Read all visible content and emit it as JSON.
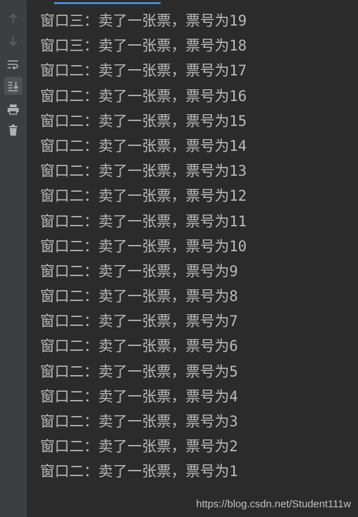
{
  "toolbar": {
    "icons": [
      {
        "name": "up-arrow-icon",
        "active": false
      },
      {
        "name": "down-arrow-icon",
        "active": false
      },
      {
        "name": "soft-wrap-icon",
        "active": false
      },
      {
        "name": "scroll-to-end-icon",
        "active": true
      },
      {
        "name": "print-icon",
        "active": false
      },
      {
        "name": "trash-icon",
        "active": false
      }
    ]
  },
  "console": {
    "lines": [
      "窗口三：卖了一张票，票号为19",
      "窗口三：卖了一张票，票号为18",
      "窗口二：卖了一张票，票号为17",
      "窗口二：卖了一张票，票号为16",
      "窗口二：卖了一张票，票号为15",
      "窗口二：卖了一张票，票号为14",
      "窗口二：卖了一张票，票号为13",
      "窗口二：卖了一张票，票号为12",
      "窗口二：卖了一张票，票号为11",
      "窗口二：卖了一张票，票号为10",
      "窗口二：卖了一张票，票号为9",
      "窗口二：卖了一张票，票号为8",
      "窗口二：卖了一张票，票号为7",
      "窗口二：卖了一张票，票号为6",
      "窗口二：卖了一张票，票号为5",
      "窗口二：卖了一张票，票号为4",
      "窗口二：卖了一张票，票号为3",
      "窗口二：卖了一张票，票号为2",
      "窗口二：卖了一张票，票号为1"
    ]
  },
  "watermark": "https://blog.csdn.net/Student111w",
  "colors": {
    "background": "#2b2b2b",
    "toolbar": "#3c3f41",
    "text": "#bbbbbb",
    "accent": "#4a88c7"
  }
}
